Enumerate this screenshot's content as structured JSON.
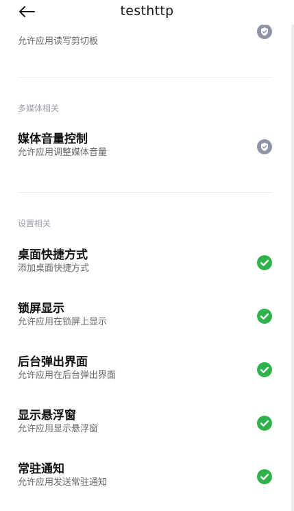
{
  "header": {
    "title": "testhttp"
  },
  "partial_item": {
    "desc": "允许应用读写剪切板",
    "status": "gray-check-icon"
  },
  "sections": {
    "media": {
      "title": "多媒体相关",
      "items": [
        {
          "label": "媒体音量控制",
          "desc": "允许应用调整媒体音量",
          "status": "gray-check-icon"
        }
      ]
    },
    "settings": {
      "title": "设置相关",
      "items": [
        {
          "label": "桌面快捷方式",
          "desc": "添加桌面快捷方式",
          "status": "green-check-icon"
        },
        {
          "label": "锁屏显示",
          "desc": "允许应用在锁屏上显示",
          "status": "green-check-icon"
        },
        {
          "label": "后台弹出界面",
          "desc": "允许应用在后台弹出界面",
          "status": "green-check-icon"
        },
        {
          "label": "显示悬浮窗",
          "desc": "允许应用显示悬浮窗",
          "status": "green-check-icon"
        },
        {
          "label": "常驻通知",
          "desc": "允许应用发送常驻通知",
          "status": "green-check-icon"
        }
      ]
    }
  },
  "colors": {
    "granted": "#2fb24c",
    "default": "#8f95a8"
  }
}
